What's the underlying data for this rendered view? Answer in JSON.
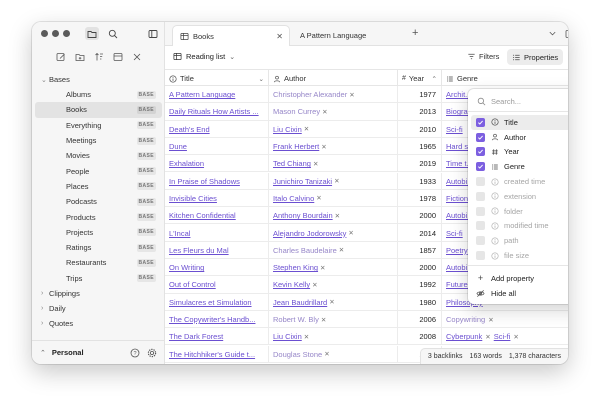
{
  "sidebar": {
    "folders": {
      "bases": "Bases",
      "clippings": "Clippings",
      "daily": "Daily",
      "quotes": "Quotes"
    },
    "badge": "BASE",
    "items": [
      {
        "label": "Albums"
      },
      {
        "label": "Books",
        "active": true
      },
      {
        "label": "Everything"
      },
      {
        "label": "Meetings"
      },
      {
        "label": "Movies"
      },
      {
        "label": "People"
      },
      {
        "label": "Places"
      },
      {
        "label": "Podcasts"
      },
      {
        "label": "Products"
      },
      {
        "label": "Projects"
      },
      {
        "label": "Ratings"
      },
      {
        "label": "Restaurants"
      },
      {
        "label": "Trips"
      }
    ],
    "vault_name": "Personal"
  },
  "tabs": [
    {
      "label": "Books",
      "active": true
    },
    {
      "label": "A Pattern Language",
      "active": false
    }
  ],
  "view": {
    "name": "Reading list",
    "filters_label": "Filters",
    "properties_label": "Properties"
  },
  "table": {
    "columns": {
      "title": "Title",
      "author": "Author",
      "year": "Year",
      "genre": "Genre"
    },
    "rows": [
      {
        "title": "A Pattern Language",
        "author": "Christopher Alexander",
        "author_muted": true,
        "year": "1977",
        "genres": [
          "Archit..."
        ],
        "genre_muted": [
          false
        ]
      },
      {
        "title": "Daily Rituals How Artists ...",
        "author": "Mason Currey",
        "author_muted": true,
        "year": "2013",
        "genres": [
          "Biogra..."
        ],
        "genre_muted": [
          false
        ]
      },
      {
        "title": "Death's End",
        "author": "Liu Cixin",
        "author_muted": false,
        "year": "2010",
        "genres": [
          "Sci-fi"
        ],
        "genre_muted": [
          false
        ]
      },
      {
        "title": "Dune",
        "author": "Frank Herbert",
        "author_muted": false,
        "year": "1965",
        "genres": [
          "Hard s..."
        ],
        "genre_muted": [
          false
        ]
      },
      {
        "title": "Exhalation",
        "author": "Ted Chiang",
        "author_muted": false,
        "year": "2019",
        "genres": [
          "Time t..."
        ],
        "genre_muted": [
          false
        ]
      },
      {
        "title": "In Praise of Shadows",
        "author": "Junichiro Tanizaki",
        "author_muted": false,
        "year": "1933",
        "genres": [
          "Autobi..."
        ],
        "genre_muted": [
          false
        ]
      },
      {
        "title": "Invisible Cities",
        "author": "Italo Calvino",
        "author_muted": false,
        "year": "1978",
        "genres": [
          "Fiction"
        ],
        "genre_muted": [
          false
        ]
      },
      {
        "title": "Kitchen Confidential",
        "author": "Anthony Bourdain",
        "author_muted": false,
        "year": "2000",
        "genres": [
          "Autobi..."
        ],
        "genre_muted": [
          false
        ]
      },
      {
        "title": "L'Incal",
        "author": "Alejandro Jodorowsky",
        "author_muted": false,
        "year": "2014",
        "genres": [
          "Sci-fi"
        ],
        "genre_muted": [
          false
        ]
      },
      {
        "title": "Les Fleurs du Mal",
        "author": "Charles Baudelaire",
        "author_muted": true,
        "year": "1857",
        "genres": [
          "Poetry"
        ],
        "genre_muted": [
          false
        ]
      },
      {
        "title": "On Writing",
        "author": "Stephen King",
        "author_muted": false,
        "year": "2000",
        "genres": [
          "Autobi..."
        ],
        "genre_muted": [
          false
        ]
      },
      {
        "title": "Out of Control",
        "author": "Kevin Kelly",
        "author_muted": false,
        "year": "1992",
        "genres": [
          "Future..."
        ],
        "genre_muted": [
          false
        ]
      },
      {
        "title": "Simulacres et Simulation",
        "author": "Jean Baudrillard",
        "author_muted": false,
        "year": "1980",
        "genres": [
          "Philosophy"
        ],
        "genre_muted": [
          false
        ]
      },
      {
        "title": "The Copywriter's Handb...",
        "author": "Robert W. Bly",
        "author_muted": true,
        "year": "2006",
        "genres": [
          "Copywriting"
        ],
        "genre_muted": [
          true
        ]
      },
      {
        "title": "The Dark Forest",
        "author": "Liu Cixin",
        "author_muted": false,
        "year": "2008",
        "genres": [
          "Cyberpunk",
          "Sci-fi"
        ],
        "genre_muted": [
          false,
          false
        ]
      },
      {
        "title": "The Hitchhiker's Guide t...",
        "author": "Douglas Stone",
        "author_muted": true,
        "year": "1980",
        "genres": [],
        "genre_muted": []
      }
    ]
  },
  "popover": {
    "search_placeholder": "Search...",
    "properties": [
      {
        "label": "Title",
        "checked": true,
        "icon": "info-icon",
        "highlighted": true
      },
      {
        "label": "Author",
        "checked": true,
        "icon": "person-icon"
      },
      {
        "label": "Year",
        "checked": true,
        "icon": "number-icon"
      },
      {
        "label": "Genre",
        "checked": true,
        "icon": "list-icon"
      },
      {
        "label": "created time",
        "checked": false,
        "icon": "info-icon"
      },
      {
        "label": "extension",
        "checked": false,
        "icon": "info-icon"
      },
      {
        "label": "folder",
        "checked": false,
        "icon": "info-icon"
      },
      {
        "label": "modified time",
        "checked": false,
        "icon": "info-icon"
      },
      {
        "label": "path",
        "checked": false,
        "icon": "info-icon"
      },
      {
        "label": "file size",
        "checked": false,
        "icon": "info-icon"
      }
    ],
    "add_property": "Add property",
    "hide_all": "Hide all"
  },
  "status": {
    "backlinks": "3 backlinks",
    "words": "163 words",
    "characters": "1,378 characters"
  },
  "colors": {
    "accent": "#7c5fe0",
    "link": "#6b4fd1"
  }
}
